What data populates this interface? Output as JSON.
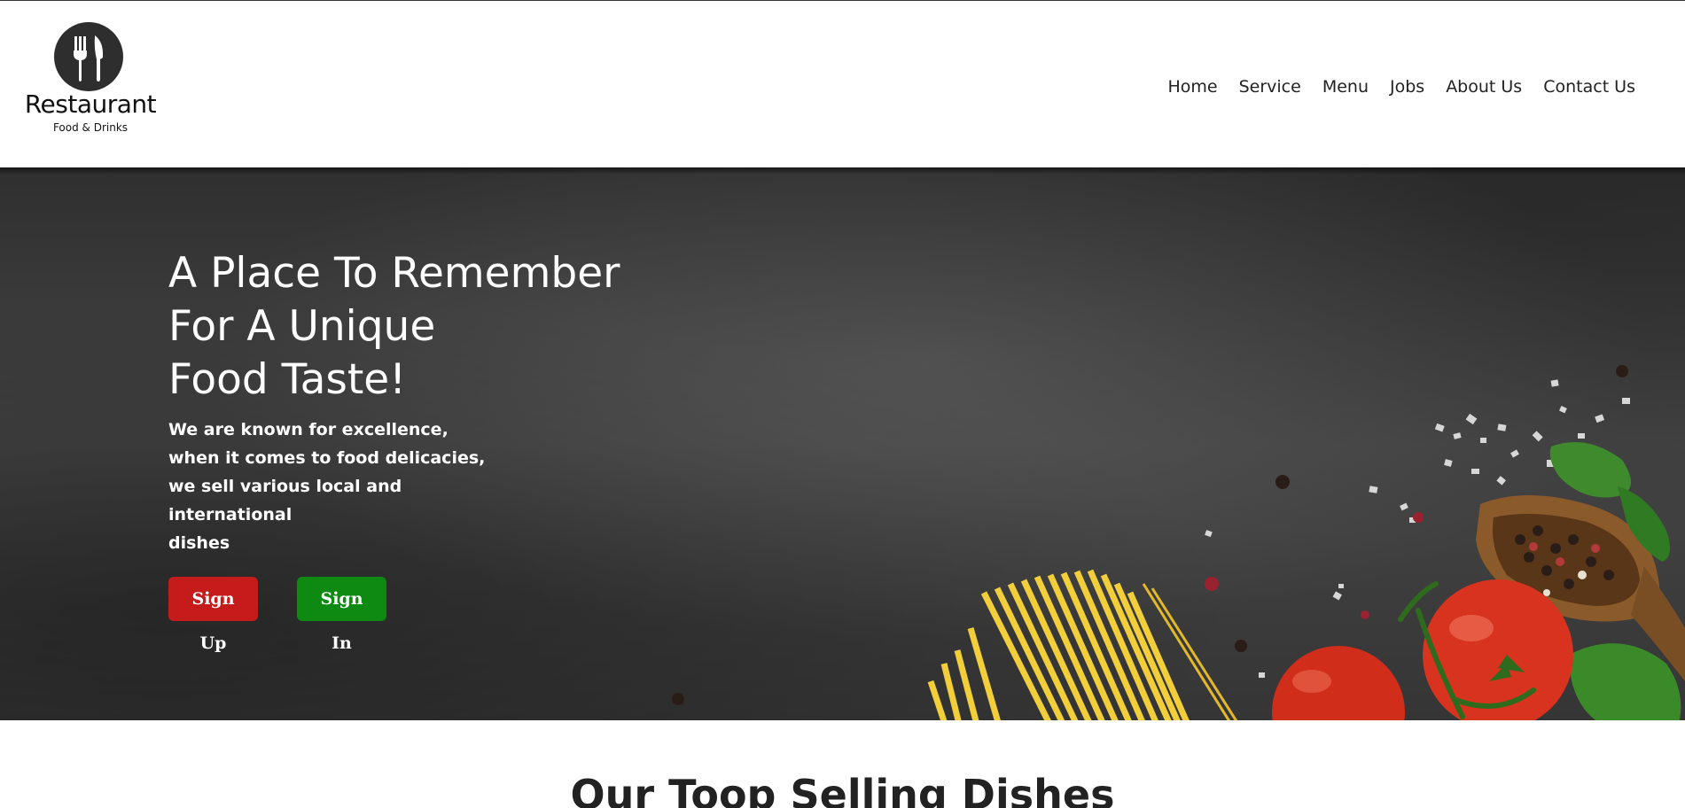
{
  "logo": {
    "icon": "fork-knife-icon",
    "title": "Restaurant",
    "subtitle": "Food & Drinks"
  },
  "nav": {
    "items": [
      {
        "label": "Home"
      },
      {
        "label": "Service"
      },
      {
        "label": "Menu"
      },
      {
        "label": "Jobs"
      },
      {
        "label": "About Us"
      },
      {
        "label": "Contact Us"
      }
    ]
  },
  "hero": {
    "title_lines": [
      "A Place To Remember",
      "For A Unique",
      "Food Taste!"
    ],
    "desc_lines": [
      "We are known for excellence,",
      "when it comes to food delicacies,",
      "we sell various local and international",
      "dishes"
    ],
    "signup_label": "Sign Up",
    "signin_label": "Sign In",
    "colors": {
      "signup": "#c51b1b",
      "signin": "#0e8a13",
      "background": "#3e3e3e"
    }
  },
  "section": {
    "title": "Our Toop Selling Dishes"
  }
}
